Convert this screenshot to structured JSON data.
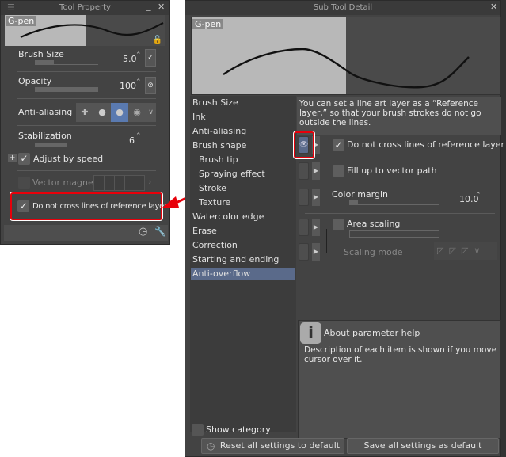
{
  "tool_property": {
    "title": "Tool Property",
    "brush_name": "G-pen",
    "brush_size": {
      "label": "Brush Size",
      "value": "5.0",
      "fraction": 0.3
    },
    "opacity": {
      "label": "Opacity",
      "value": "100",
      "fraction": 1.0
    },
    "anti_aliasing": {
      "label": "Anti-aliasing",
      "selected_index": 2
    },
    "stabilization": {
      "label": "Stabilization",
      "value": "6",
      "fraction": 0.5
    },
    "adjust_by_speed": {
      "label": "Adjust by speed",
      "checked": true
    },
    "vector_magnet": {
      "label": "Vector magnet",
      "checked": false
    },
    "reference_layer": {
      "label": "Do not cross lines of reference layer",
      "checked": true
    }
  },
  "sub_tool_detail": {
    "title": "Sub Tool Detail",
    "brush_name": "G-pen",
    "categories": [
      "Brush Size",
      "Ink",
      "Anti-aliasing",
      "Brush shape",
      "Brush tip",
      "Spraying effect",
      "Stroke",
      "Texture",
      "Watercolor edge",
      "Erase",
      "Correction",
      "Starting and ending",
      "Anti-overflow"
    ],
    "selected_category": "Anti-overflow",
    "description": "You can set a line art layer as a “Reference layer,” so that your brush strokes do not go outside the lines.",
    "settings": {
      "no_cross": {
        "label": "Do not cross lines of reference layer",
        "checked": true
      },
      "fill_vector": {
        "label": "Fill up to vector path",
        "checked": false
      },
      "color_margin": {
        "label": "Color margin",
        "value": "10.0",
        "fraction": 0.1
      },
      "area_scaling": {
        "label": "Area scaling",
        "checked": false
      },
      "scaling_mode": {
        "label": "Scaling mode"
      }
    },
    "help": {
      "title": "About parameter help",
      "text": "Description of each item is shown if you move cursor over it."
    },
    "show_category": {
      "label": "Show category",
      "checked": false
    },
    "reset_button": "Reset all settings to default",
    "save_button": "Save all settings as default"
  },
  "colors": {
    "highlight": "#5a6a8a",
    "annotation": "#e8000a"
  }
}
